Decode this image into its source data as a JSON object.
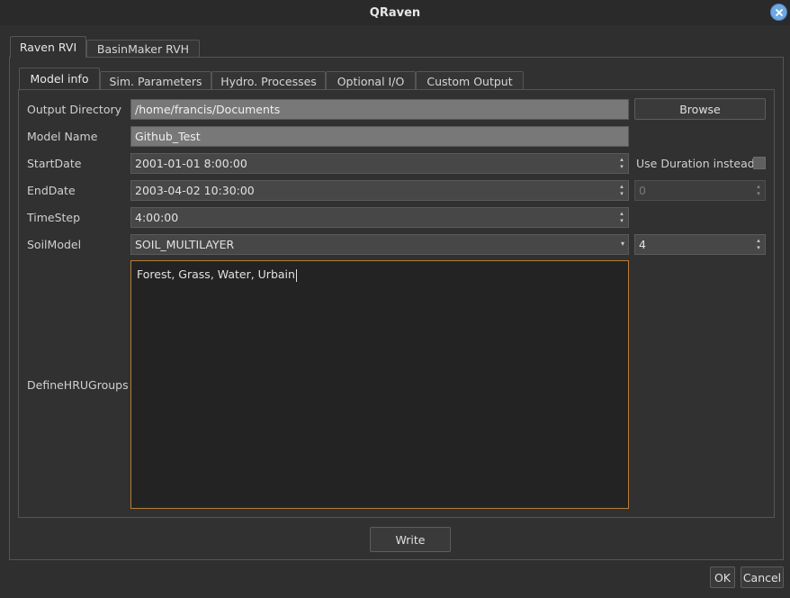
{
  "window": {
    "title": "QRaven",
    "close_icon": "close-icon"
  },
  "outer_tabs": [
    {
      "label": "Raven RVI",
      "active": true
    },
    {
      "label": "BasinMaker RVH",
      "active": false
    }
  ],
  "inner_tabs": [
    {
      "label": "Model info",
      "active": true
    },
    {
      "label": "Sim. Parameters",
      "active": false
    },
    {
      "label": "Hydro. Processes",
      "active": false
    },
    {
      "label": "Optional I/O",
      "active": false
    },
    {
      "label": "Custom Output",
      "active": false
    }
  ],
  "form": {
    "output_directory": {
      "label": "Output Directory",
      "value": "/home/francis/Documents",
      "button": "Browse"
    },
    "model_name": {
      "label": "Model Name",
      "value": "Github_Test"
    },
    "start_date": {
      "label": "StartDate",
      "value": "2001-01-01 8:00:00"
    },
    "use_duration": {
      "label": "Use Duration instead",
      "checked": false
    },
    "end_date": {
      "label": "EndDate",
      "value": "2003-04-02 10:30:00"
    },
    "duration": {
      "value": "0",
      "disabled": true
    },
    "time_step": {
      "label": "TimeStep",
      "value": "4:00:00"
    },
    "soil_model": {
      "label": "SoilModel",
      "value": "SOIL_MULTILAYER",
      "layers": "4"
    },
    "hru_groups": {
      "label": "DefineHRUGroups",
      "value": "Forest, Grass, Water, Urbain"
    }
  },
  "actions": {
    "write": "Write",
    "ok": "OK",
    "cancel": "Cancel"
  },
  "colors": {
    "background": "#2f2f2f",
    "focus_border": "#b87d3a",
    "close_button": "#6fa9e0"
  }
}
